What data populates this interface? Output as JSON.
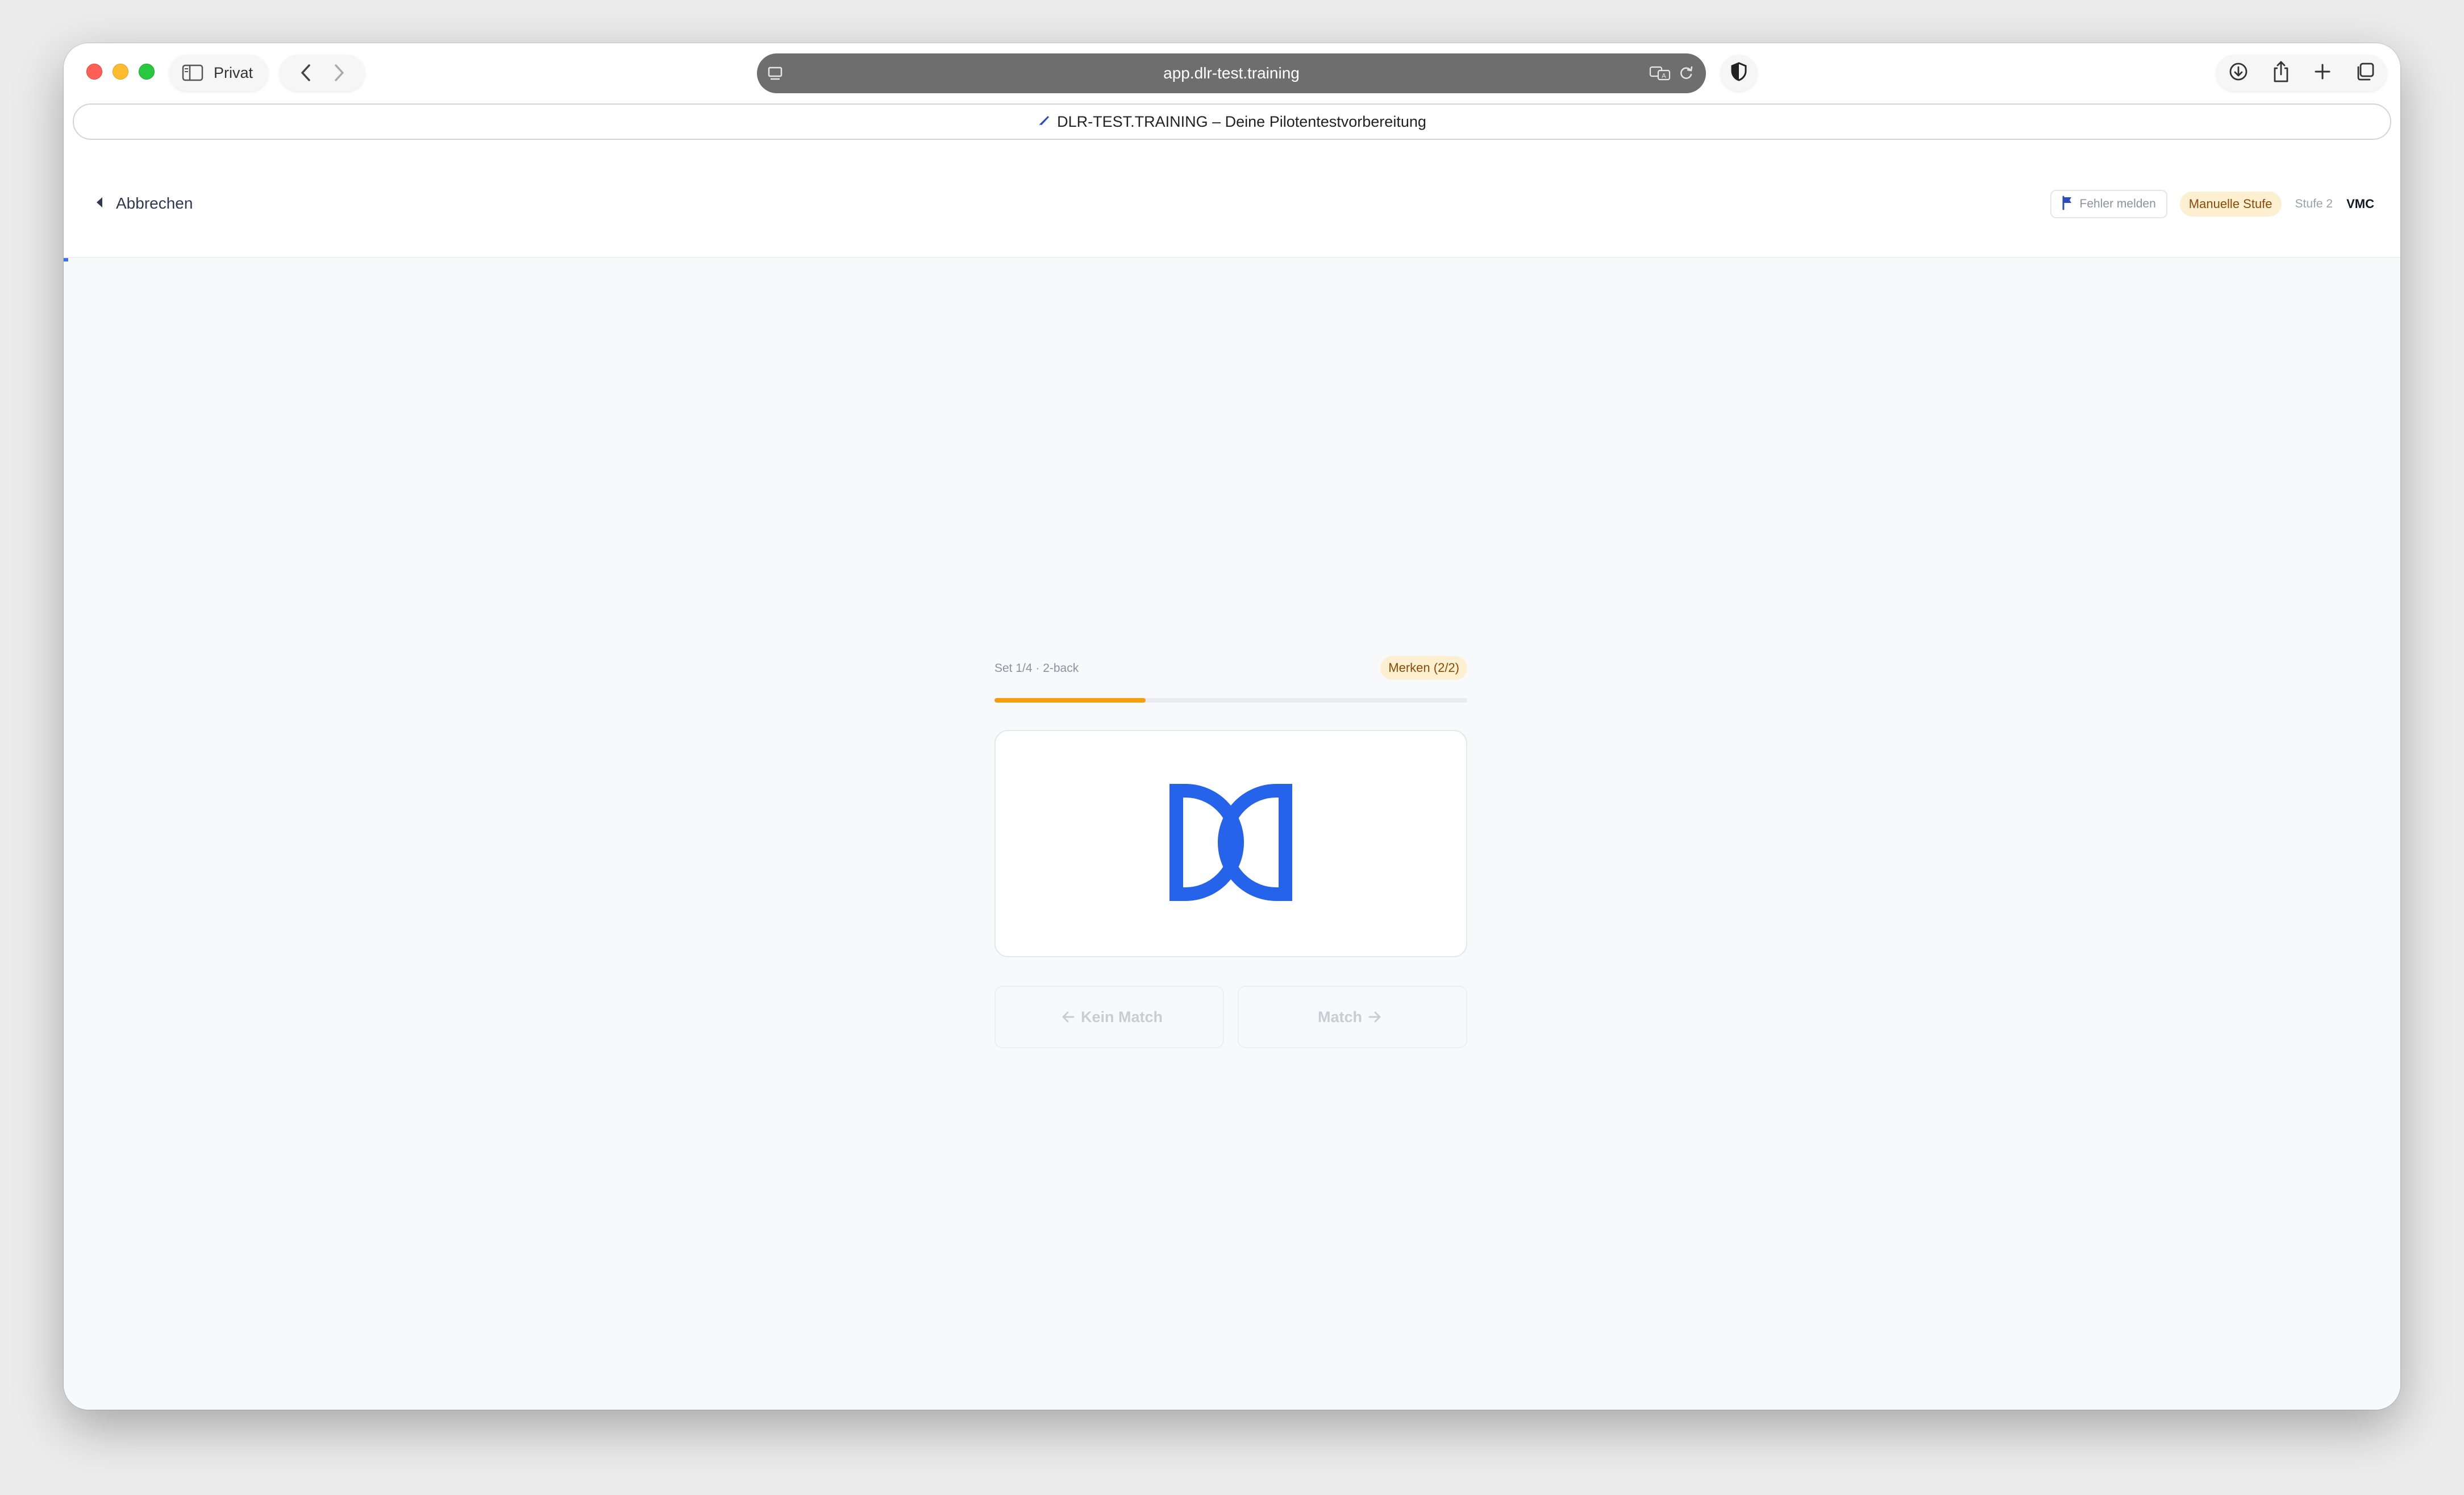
{
  "browser": {
    "profile_label": "Privat",
    "url": "app.dlr-test.training",
    "tab_title": "DLR-TEST.TRAINING – Deine Pilotentestvorbereitung"
  },
  "header": {
    "cancel_label": "Abbrechen",
    "report_label": "Fehler melden",
    "stage_badge": "Manuelle Stufe",
    "stage_level": "Stufe 2",
    "mode": "VMC"
  },
  "task": {
    "set_info": "Set 1/4 · 2-back",
    "phase_badge": "Merken (2/2)",
    "progress_fraction": 0.32,
    "stimulus_icon": "mirrored-d-shape-icon",
    "stimulus_color": "#2563eb",
    "no_match_label": "Kein Match",
    "match_label": "Match"
  },
  "colors": {
    "accent": "#f59e0b",
    "badge_bg": "#fdf0d0",
    "badge_text": "#8a4a06",
    "primary": "#2563eb"
  }
}
